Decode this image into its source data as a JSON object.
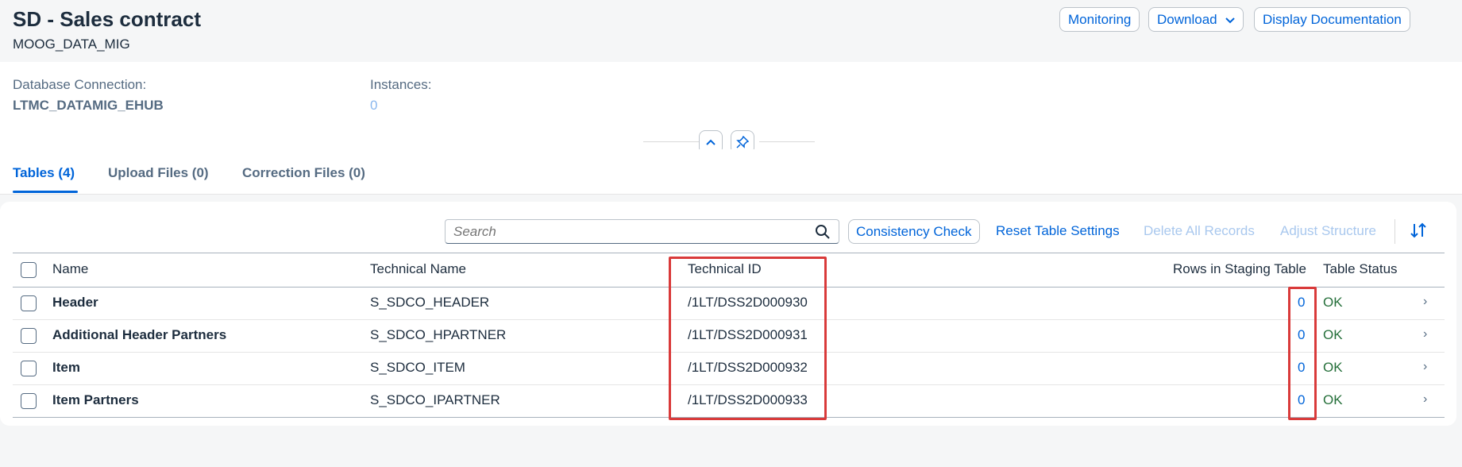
{
  "header": {
    "title": "SD - Sales contract",
    "subtitle": "MOOG_DATA_MIG",
    "buttons": {
      "monitoring": "Monitoring",
      "download": "Download",
      "display_documentation": "Display Documentation"
    }
  },
  "facets": {
    "db_connection_label": "Database Connection:",
    "db_connection_value": "LTMC_DATAMIG_EHUB",
    "instances_label": "Instances:",
    "instances_value": "0"
  },
  "tabs": [
    {
      "label": "Tables (4)",
      "active": true
    },
    {
      "label": "Upload Files (0)",
      "active": false
    },
    {
      "label": "Correction Files (0)",
      "active": false
    }
  ],
  "toolbar": {
    "search_placeholder": "Search",
    "consistency_check": "Consistency Check",
    "reset_table_settings": "Reset Table Settings",
    "delete_all_records": "Delete All Records",
    "adjust_structure": "Adjust Structure"
  },
  "table": {
    "columns": {
      "name": "Name",
      "technical_name": "Technical Name",
      "technical_id": "Technical ID",
      "rows_in_staging": "Rows in Staging Table",
      "table_status": "Table Status"
    },
    "rows": [
      {
        "name": "Header",
        "technical_name": "S_SDCO_HEADER",
        "technical_id": "/1LT/DSS2D000930",
        "rows": "0",
        "status": "OK"
      },
      {
        "name": "Additional Header Partners",
        "technical_name": "S_SDCO_HPARTNER",
        "technical_id": "/1LT/DSS2D000931",
        "rows": "0",
        "status": "OK"
      },
      {
        "name": "Item",
        "technical_name": "S_SDCO_ITEM",
        "technical_id": "/1LT/DSS2D000932",
        "rows": "0",
        "status": "OK"
      },
      {
        "name": "Item Partners",
        "technical_name": "S_SDCO_IPARTNER",
        "technical_id": "/1LT/DSS2D000933",
        "rows": "0",
        "status": "OK"
      }
    ]
  },
  "icons": {
    "collapse": "chevron-up-icon",
    "pin": "pin-icon",
    "search": "search-icon",
    "sort": "sort-icon",
    "row_nav": "chevron-right-icon",
    "dropdown": "chevron-down-icon"
  },
  "colors": {
    "accent": "#0064d9",
    "ok": "#256f3a",
    "highlight": "#d93a3a",
    "disabled": "#a9c8ee"
  }
}
